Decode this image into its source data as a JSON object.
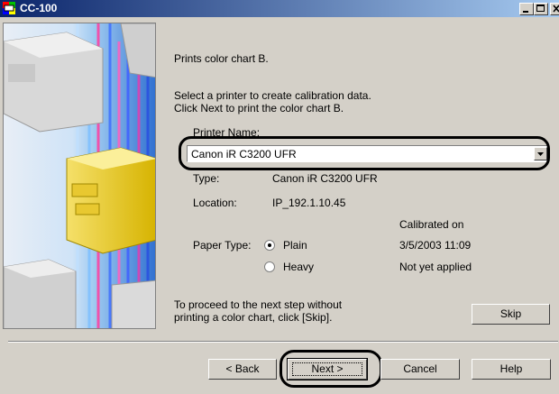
{
  "window": {
    "title": "CC-100"
  },
  "content": {
    "intro": "Prints color chart B.",
    "instruction_line1": "Select a printer to create calibration data.",
    "instruction_line2": "Click Next to print the color chart B.",
    "printer_name_label": "Printer Name:",
    "printer_name_value": "Canon iR C3200 UFR",
    "type_label": "Type:",
    "type_value": "Canon iR C3200 UFR",
    "location_label": "Location:",
    "location_value": "IP_192.1.10.45",
    "calibrated_on_label": "Calibrated on",
    "paper_type_label": "Paper Type:",
    "paper_options": [
      {
        "label": "Plain",
        "selected": true,
        "status": "3/5/2003  11:09"
      },
      {
        "label": "Heavy",
        "selected": false,
        "status": "Not yet applied"
      }
    ],
    "skip_note_line1": "To proceed to the next step without",
    "skip_note_line2": "printing a color chart, click [Skip]."
  },
  "buttons": {
    "skip": "Skip",
    "back": "< Back",
    "next": "Next >",
    "cancel": "Cancel",
    "help": "Help"
  },
  "icons": {
    "app": "app-icon",
    "minimize": "minimize-icon",
    "maximize": "maximize-icon",
    "close": "close-icon",
    "dropdown": "chevron-down-icon"
  },
  "colors": {
    "titlebar_start": "#0a246a",
    "titlebar_end": "#a6caf0",
    "dialog_face": "#d4d0c8"
  }
}
